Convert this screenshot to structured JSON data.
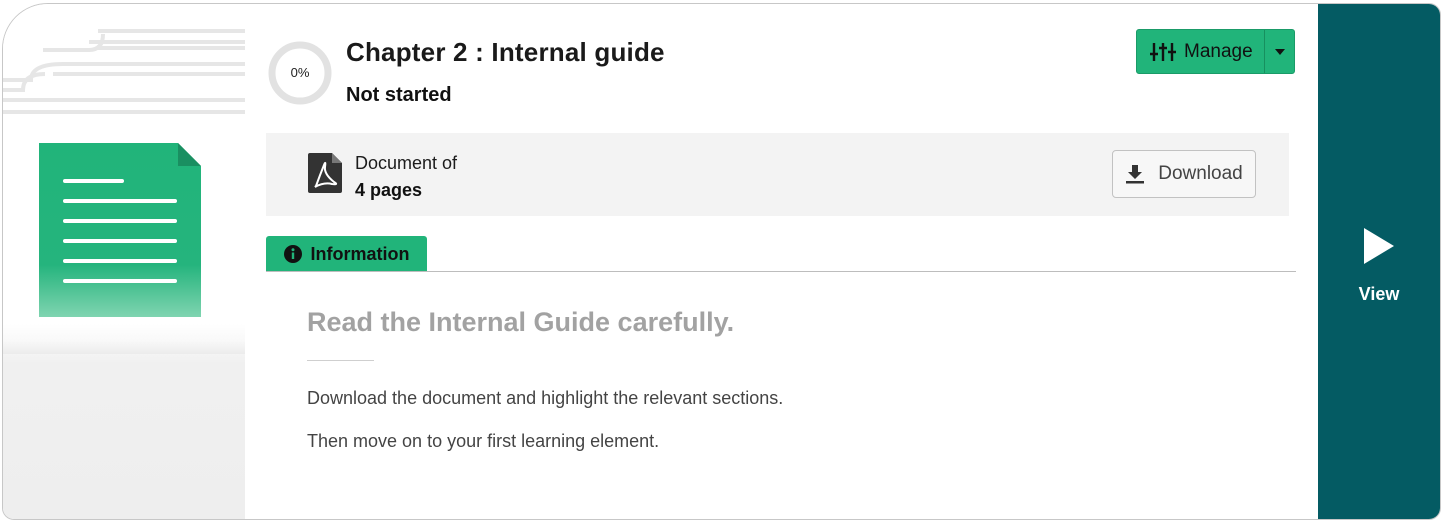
{
  "module": {
    "progress_text": "0%",
    "progress_fraction": 0,
    "title": "Chapter 2 : Internal guide",
    "status": "Not started"
  },
  "manage": {
    "label": "Manage",
    "color": "#21b47a"
  },
  "document": {
    "type_line": "Document of",
    "pages_line": "4 pages",
    "download_label": "Download"
  },
  "tab": {
    "label": "Information"
  },
  "content": {
    "heading": "Read the Internal Guide carefully.",
    "paragraphs": [
      "Download the document and highlight the relevant sections.",
      "Then move on to your first learning element."
    ]
  },
  "view": {
    "label": "View",
    "color": "#045b63"
  },
  "icons": {
    "thumbnail": "document-icon",
    "manage": "sliders-icon",
    "caret": "chevron-down-icon",
    "file": "pdf-icon",
    "download": "download-icon",
    "info": "info-icon",
    "play": "play-icon"
  }
}
